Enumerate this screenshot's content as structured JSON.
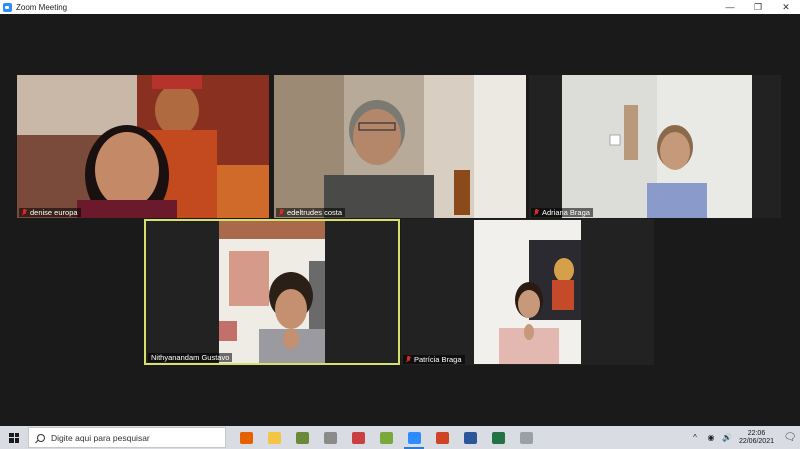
{
  "window": {
    "title": "Zoom Meeting",
    "controls": {
      "minimize": "—",
      "restore": "❐",
      "close": "✕"
    }
  },
  "participants": [
    {
      "name": "denise europa",
      "muted": true,
      "active_speaker": false
    },
    {
      "name": "edeltrudes costa",
      "muted": true,
      "active_speaker": false
    },
    {
      "name": "Adriana Braga",
      "muted": true,
      "active_speaker": false
    },
    {
      "name": "Nithyanandam Gustavo",
      "muted": false,
      "active_speaker": true
    },
    {
      "name": "Patrícia Braga",
      "muted": true,
      "active_speaker": false
    }
  ],
  "taskbar": {
    "search_placeholder": "Digite aqui para pesquisar",
    "apps": [
      {
        "name": "firefox-icon",
        "color": "#e66000"
      },
      {
        "name": "file-explorer-icon",
        "color": "#f4c542"
      },
      {
        "name": "media-player-icon",
        "color": "#6a8a3a"
      },
      {
        "name": "clock-app-icon",
        "color": "#8a8a8a"
      },
      {
        "name": "paint-icon",
        "color": "#c94040"
      },
      {
        "name": "game-icon",
        "color": "#7aa83a"
      },
      {
        "name": "zoom-icon",
        "color": "#2d8cff"
      },
      {
        "name": "powerpoint-icon",
        "color": "#d04423"
      },
      {
        "name": "word-icon",
        "color": "#2b579a"
      },
      {
        "name": "excel-icon",
        "color": "#217346"
      },
      {
        "name": "settings-app-icon",
        "color": "#9aa0a6"
      }
    ],
    "clock": {
      "time": "22:06",
      "date": "22/06/2021"
    },
    "tray": {
      "chevron": "^",
      "network": "◉",
      "volume": "🔊",
      "notifications": "🗨"
    }
  },
  "colors": {
    "active_speaker_border": "#d9e06a",
    "muted_mic": "#e02828",
    "meeting_bg": "#1a1a1a"
  }
}
